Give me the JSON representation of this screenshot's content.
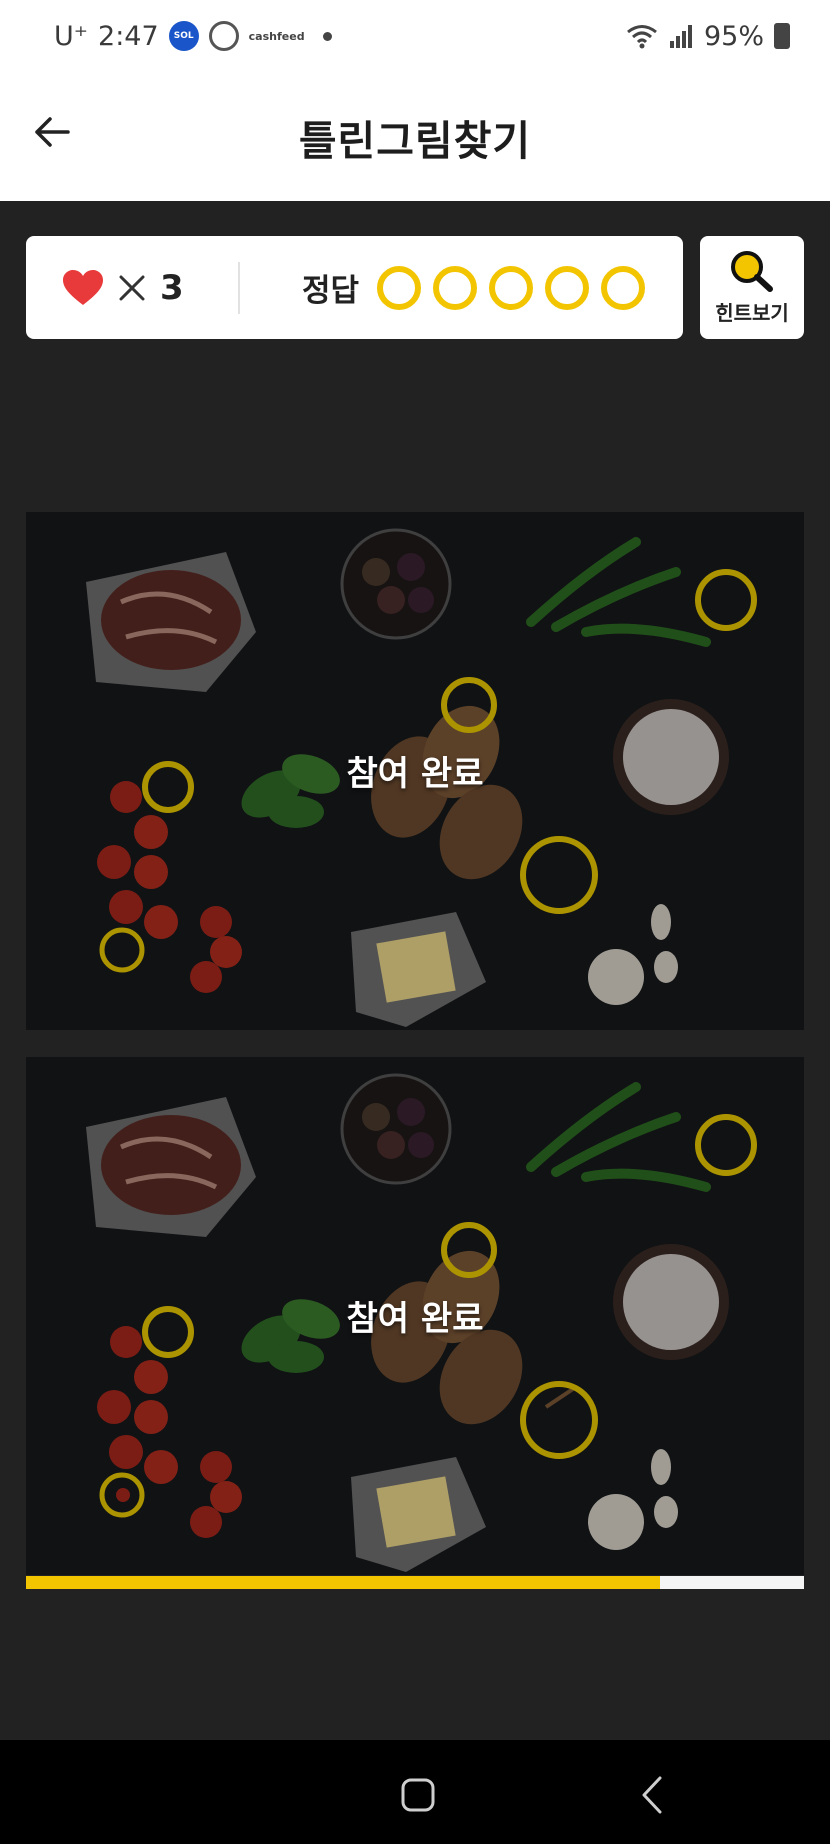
{
  "status_bar": {
    "carrier": "U⁺",
    "time": "2:47",
    "app_icons": [
      "super-sol-icon",
      "ring-app-icon",
      "cashfeed-icon"
    ],
    "app_badges": {
      "sol": "SOL",
      "cash_top": "cash",
      "cash_bottom": "feed"
    },
    "battery": "95%"
  },
  "header": {
    "title": "틀린그림찾기",
    "back_icon": "arrow-left-icon"
  },
  "game_info": {
    "lives_icon": "heart-icon",
    "lives_multiplier": "×",
    "lives_count": "3",
    "answers_label": "정답",
    "answer_slots_total": 5,
    "answers_found": 0,
    "hint_label": "힌트보기",
    "hint_icon": "magnifier-icon"
  },
  "images": {
    "top_overlay": "참여 완료",
    "bottom_overlay": "참여 완료"
  },
  "progress": {
    "fraction": 0.815
  },
  "colors": {
    "accent_yellow": "#f2c500",
    "heart_red": "#e83a3a",
    "page_bg": "#222222"
  },
  "nav": {
    "home_icon": "home-square-icon",
    "back_icon": "nav-back-icon"
  }
}
